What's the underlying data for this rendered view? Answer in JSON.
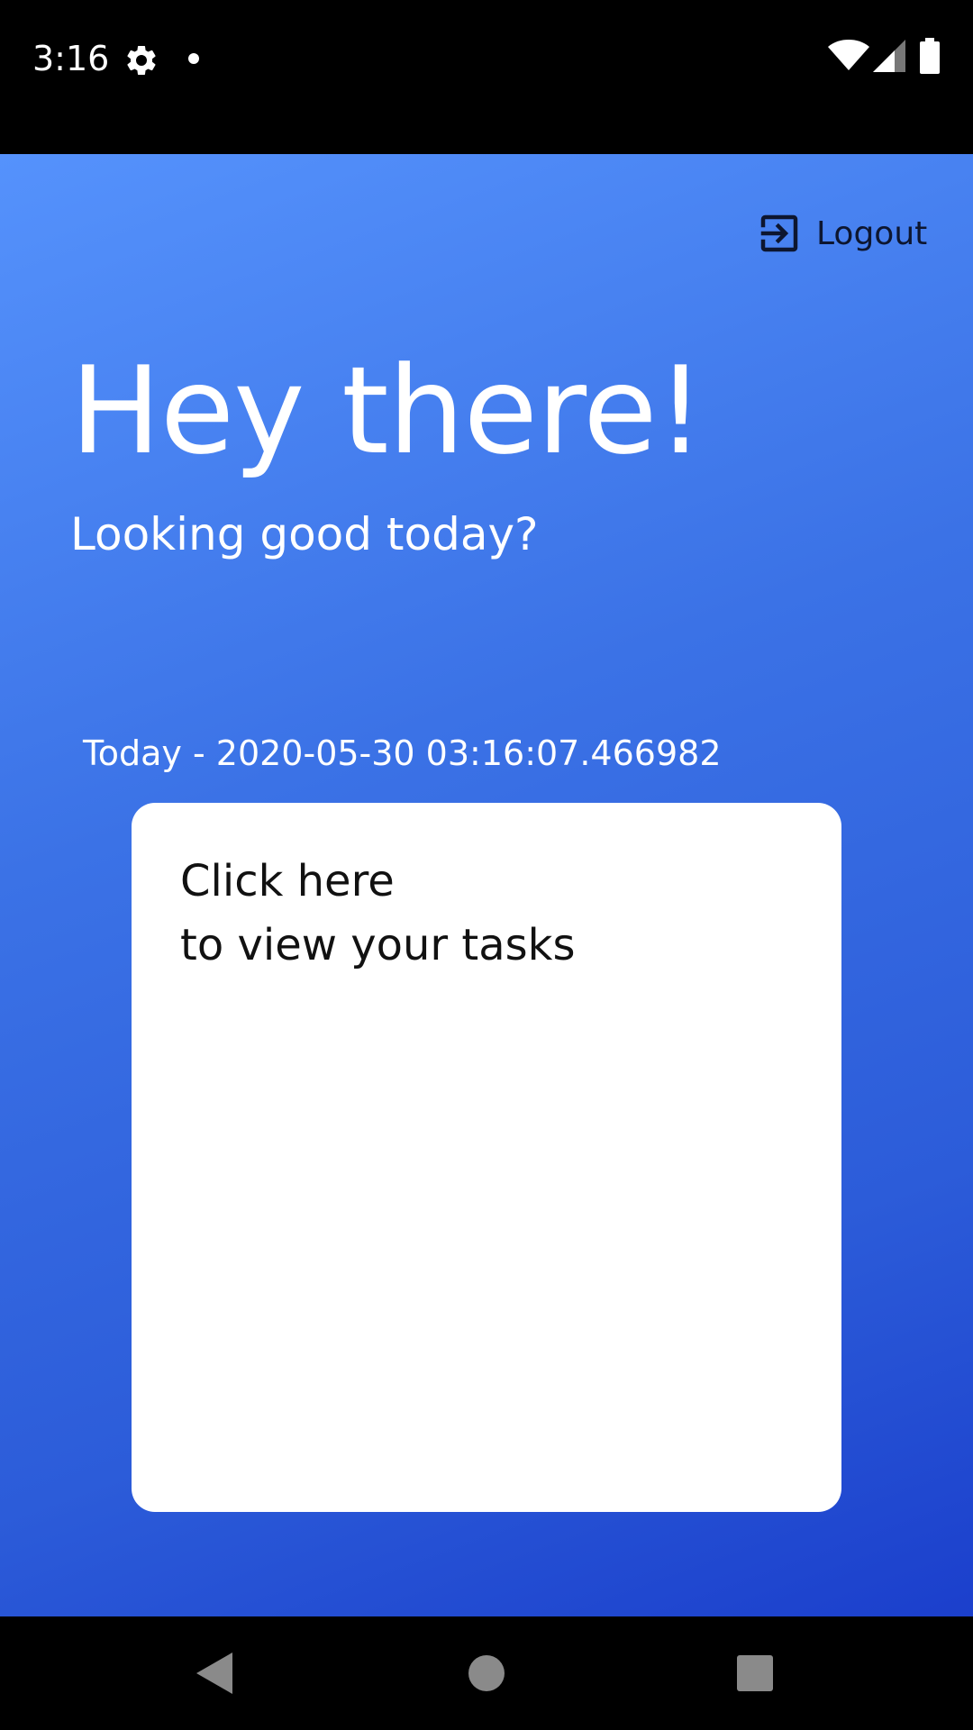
{
  "status_bar": {
    "time": "3:16",
    "icons": [
      "gear-icon",
      "notification-dot-icon",
      "wifi-icon",
      "cell-signal-icon",
      "battery-icon"
    ]
  },
  "header": {
    "logout_label": "Logout",
    "logout_icon": "logout-icon"
  },
  "main": {
    "greeting": "Hey there!",
    "subgreeting": "Looking good today?",
    "today_label": "Today - 2020-05-30 03:16:07.466982",
    "card": {
      "line1": "Click here",
      "line2": "to view your tasks"
    }
  },
  "nav_bar": {
    "icons": [
      "back-icon",
      "home-icon",
      "recents-icon"
    ]
  },
  "colors": {
    "gradient_start": "#5592fc",
    "gradient_end": "#1b3fcc",
    "card_background": "#ffffff",
    "text_light": "#ffffff",
    "text_dark": "#0d1630"
  }
}
